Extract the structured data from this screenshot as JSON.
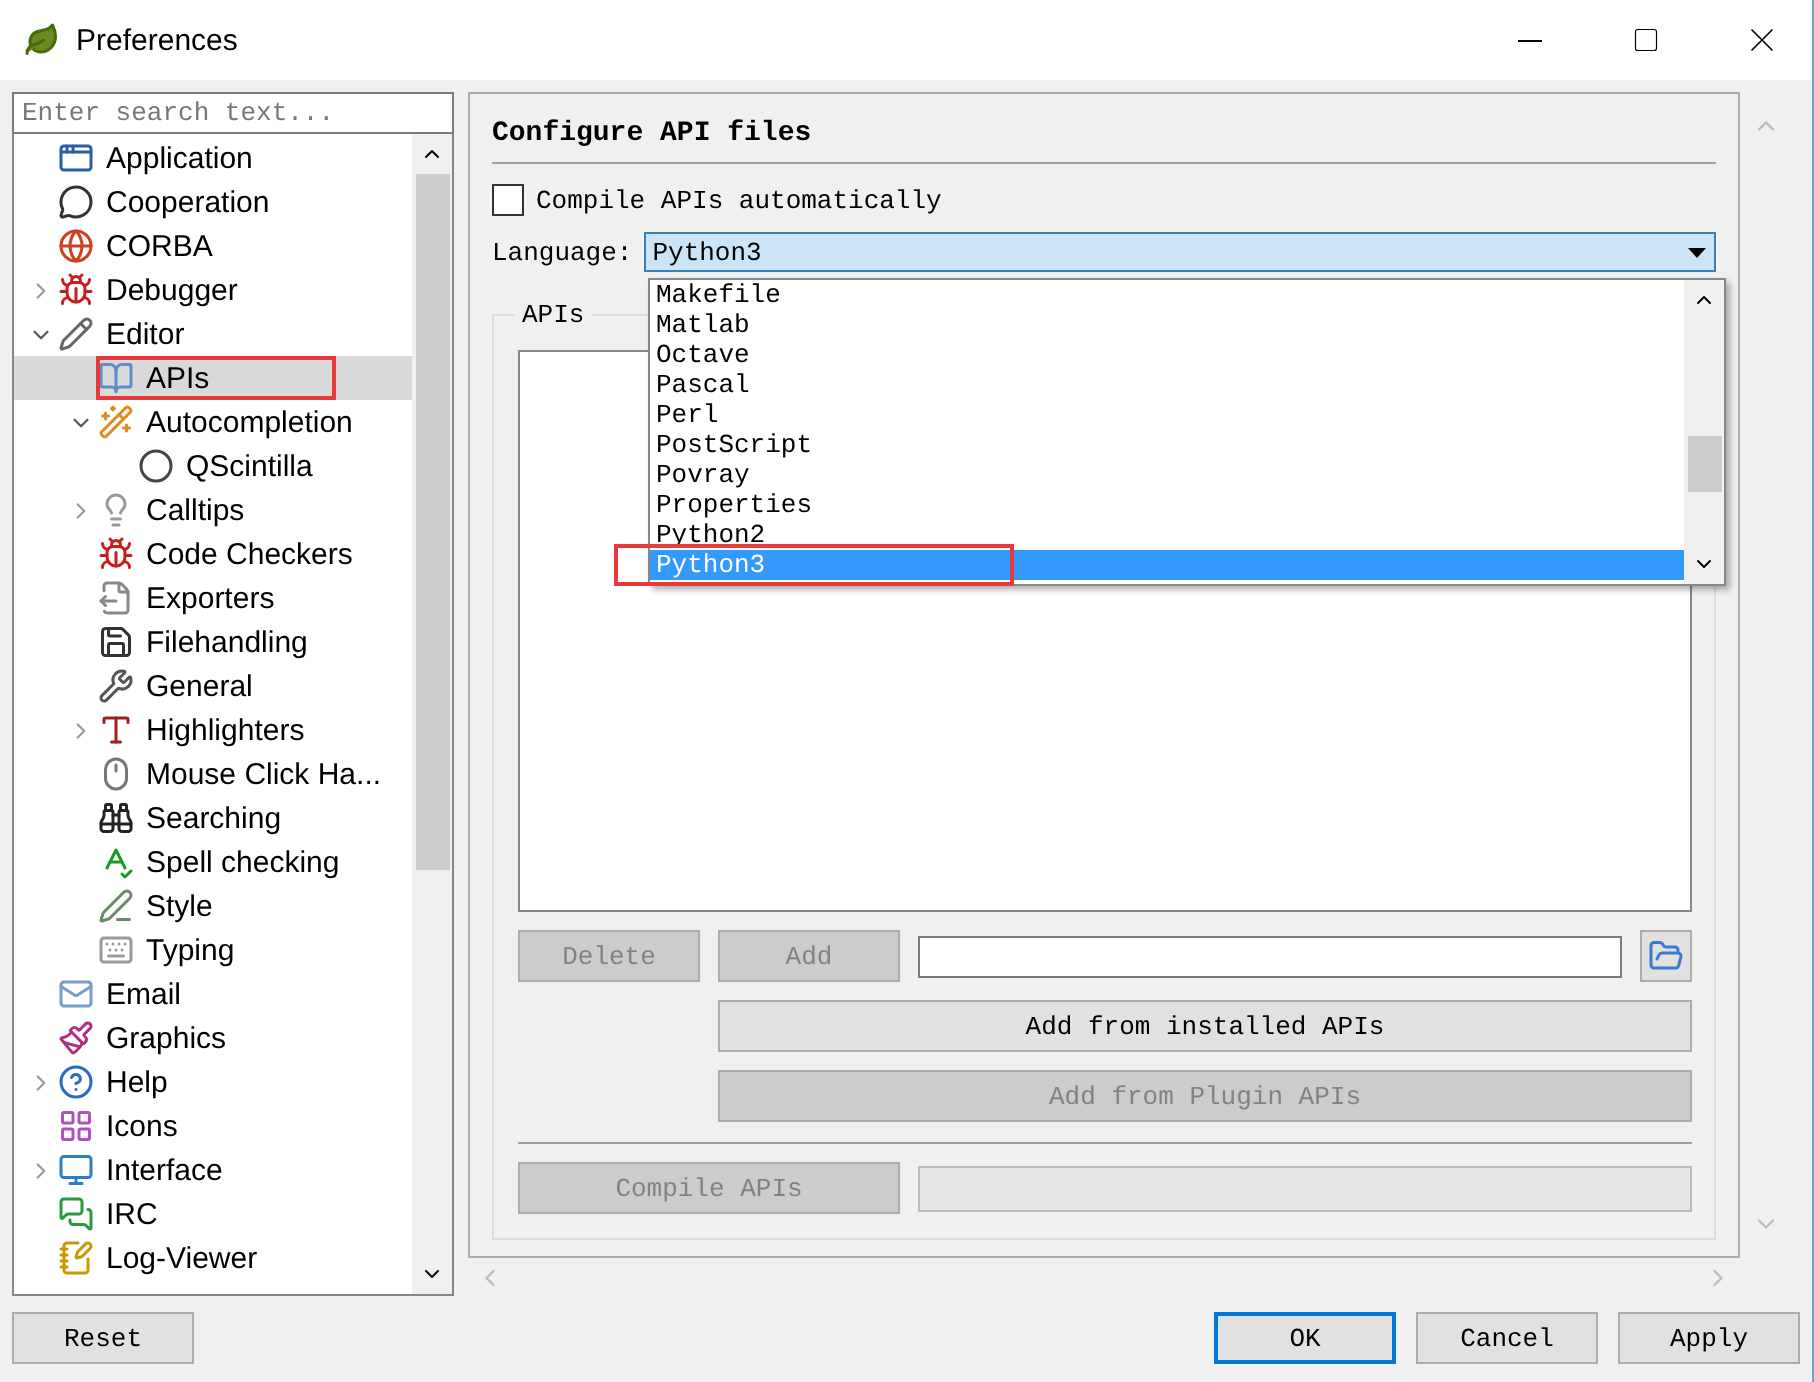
{
  "window": {
    "title": "Preferences"
  },
  "search": {
    "placeholder": "Enter search text..."
  },
  "tree": [
    {
      "label": "Application",
      "selected": false
    },
    {
      "label": "Cooperation",
      "selected": false
    },
    {
      "label": "CORBA",
      "selected": false
    },
    {
      "label": "Debugger",
      "selected": false,
      "expanded": false
    },
    {
      "label": "Editor",
      "selected": false,
      "expanded": true,
      "children": [
        {
          "label": "APIs",
          "selected": true,
          "annotated": true
        },
        {
          "label": "Autocompletion",
          "selected": false,
          "expanded": true,
          "children": [
            {
              "label": "QScintilla",
              "selected": false
            }
          ]
        },
        {
          "label": "Calltips",
          "selected": false,
          "expanded": false
        },
        {
          "label": "Code Checkers",
          "selected": false
        },
        {
          "label": "Exporters",
          "selected": false
        },
        {
          "label": "Filehandling",
          "selected": false
        },
        {
          "label": "General",
          "selected": false
        },
        {
          "label": "Highlighters",
          "selected": false,
          "expanded": false
        },
        {
          "label": "Mouse Click Ha...",
          "selected": false
        },
        {
          "label": "Searching",
          "selected": false
        },
        {
          "label": "Spell checking",
          "selected": false
        },
        {
          "label": "Style",
          "selected": false
        },
        {
          "label": "Typing",
          "selected": false
        }
      ]
    },
    {
      "label": "Email",
      "selected": false
    },
    {
      "label": "Graphics",
      "selected": false
    },
    {
      "label": "Help",
      "selected": false,
      "expanded": false
    },
    {
      "label": "Icons",
      "selected": false
    },
    {
      "label": "Interface",
      "selected": false,
      "expanded": false
    },
    {
      "label": "IRC",
      "selected": false
    },
    {
      "label": "Log-Viewer",
      "selected": false
    }
  ],
  "page": {
    "title": "Configure API files",
    "compile_automatically": {
      "label": "Compile APIs automatically",
      "checked": false
    },
    "language": {
      "label": "Language:",
      "value": "Python3",
      "options": [
        {
          "label": "Makefile",
          "selected": false
        },
        {
          "label": "Matlab",
          "selected": false
        },
        {
          "label": "Octave",
          "selected": false
        },
        {
          "label": "Pascal",
          "selected": false
        },
        {
          "label": "Perl",
          "selected": false
        },
        {
          "label": "PostScript",
          "selected": false
        },
        {
          "label": "Povray",
          "selected": false
        },
        {
          "label": "Properties",
          "selected": false
        },
        {
          "label": "Python2",
          "selected": false
        },
        {
          "label": "Python3",
          "selected": true,
          "annotated": true
        }
      ]
    },
    "apis_group": {
      "title": "APIs",
      "delete_button": {
        "label": "Delete",
        "disabled": true
      },
      "add_button": {
        "label": "Add",
        "disabled": true
      },
      "add_installed_button": {
        "label": "Add from installed APIs",
        "disabled": false
      },
      "add_plugin_button": {
        "label": "Add from Plugin APIs",
        "disabled": true
      },
      "compile_button": {
        "label": "Compile APIs",
        "disabled": true
      },
      "compile_progress": {
        "level": 0
      }
    }
  },
  "buttons": [
    {
      "label": "Reset",
      "default": false
    },
    {
      "label": "OK",
      "default": true
    },
    {
      "label": "Cancel",
      "default": false
    },
    {
      "label": "Apply",
      "default": false
    }
  ]
}
